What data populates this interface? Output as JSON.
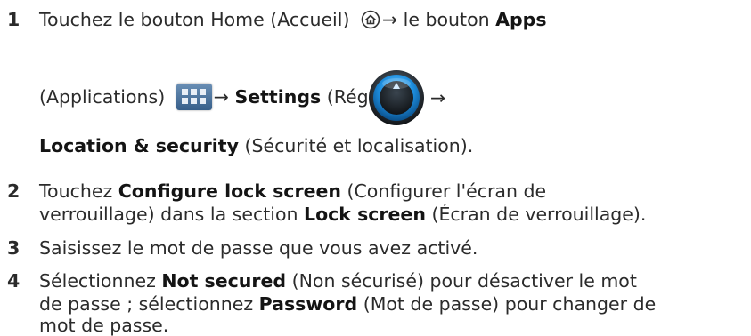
{
  "steps": [
    {
      "number": "1",
      "line1": {
        "t1": "Touchez le bouton Home (Accueil) ",
        "t2": " le bouton ",
        "b1": "Apps"
      },
      "line2": {
        "t1": "(Applications) ",
        "b1": "Settings",
        "t2": " (Réglages) "
      },
      "line3": {
        "b1": "Location & security",
        "t1": " (Sécurité et localisation)."
      }
    },
    {
      "number": "2",
      "line1": {
        "t1": "Touchez ",
        "b1": "Configure lock screen",
        "t2": " (Configurer l'écran de"
      },
      "line2": {
        "t1": "verrouillage) dans la section ",
        "b1": "Lock screen",
        "t2": " (Écran de verrouillage)."
      }
    },
    {
      "number": "3",
      "line1": {
        "t1": "Saisissez le mot de passe que vous avez activé."
      }
    },
    {
      "number": "4",
      "line1": {
        "t1": "Sélectionnez ",
        "b1": "Not secured",
        "t2": " (Non sécurisé) pour désactiver le mot"
      },
      "line2": {
        "t1": "de passe ; sélectionnez ",
        "b1": "Password",
        "t2": " (Mot de passe) pour changer de"
      },
      "line3": {
        "t1": "mot de passe."
      }
    }
  ],
  "arrow": "→",
  "icons": {
    "home": "home-icon",
    "apps": "apps-grid-icon",
    "settings": "settings-dial-icon"
  }
}
